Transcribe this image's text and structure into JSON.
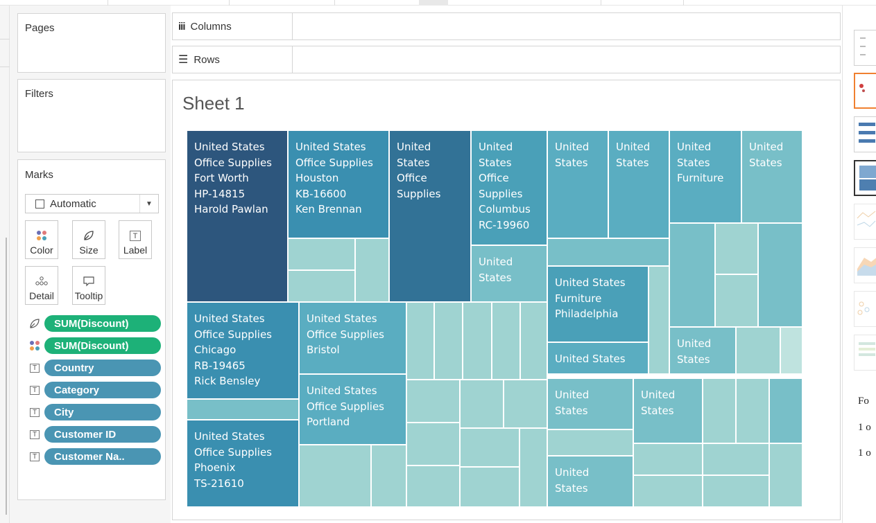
{
  "shelves": {
    "pages_label": "Pages",
    "filters_label": "Filters",
    "columns_label": "Columns",
    "rows_label": "Rows"
  },
  "marks": {
    "title": "Marks",
    "mark_type": "Automatic",
    "buttons": {
      "color": "Color",
      "size": "Size",
      "label": "Label",
      "detail": "Detail",
      "tooltip": "Tooltip"
    },
    "pills": [
      {
        "icon": "size-icon",
        "text": "SUM(Discount)",
        "style": "green"
      },
      {
        "icon": "color-icon",
        "text": "SUM(Discount)",
        "style": "green"
      },
      {
        "icon": "label-icon",
        "text": "Country",
        "style": "blue"
      },
      {
        "icon": "label-icon",
        "text": "Category",
        "style": "blue"
      },
      {
        "icon": "label-icon",
        "text": "City",
        "style": "blue"
      },
      {
        "icon": "label-icon",
        "text": "Customer ID",
        "style": "blue"
      },
      {
        "icon": "label-icon",
        "text": "Customer Na..",
        "style": "blue"
      }
    ]
  },
  "sheet_title": "Sheet 1",
  "colors": {
    "c1": "#2d567d",
    "c2": "#3a8fb0",
    "c3": "#327296",
    "c4": "#4aa0b8",
    "c5": "#5aadc1",
    "c6": "#78bfc8",
    "c7": "#9fd3d1",
    "c8": "#bfe3df",
    "green": "#1db178",
    "blue": "#4a95b3"
  },
  "tiles": {
    "t1": [
      "United States",
      "Office Supplies",
      "Fort Worth",
      "HP-14815",
      "Harold Pawlan"
    ],
    "t2": [
      "United States",
      "Office Supplies",
      "Houston",
      "KB-16600",
      "Ken Brennan"
    ],
    "t3": [
      "United",
      "States",
      "Office",
      "Supplies"
    ],
    "t4": [
      "United",
      "States",
      "Office",
      "Supplies",
      "Columbus",
      "RC-19960"
    ],
    "t5": [
      "United",
      "States"
    ],
    "t6": [
      "United",
      "States"
    ],
    "t7": [
      "United",
      "States"
    ],
    "t8": [
      "United",
      "States",
      "Furniture"
    ],
    "t9": [
      "United",
      "States"
    ],
    "t10": [
      "United States",
      "Furniture",
      "Philadelphia"
    ],
    "t11": [
      "United States"
    ],
    "t12": [
      "United",
      "States"
    ],
    "t13": [
      "United States",
      "Office Supplies",
      "Chicago",
      "RB-19465",
      "Rick Bensley"
    ],
    "t14": [
      "United States",
      "Office Supplies",
      "Bristol"
    ],
    "t15": [
      "United States",
      "Office Supplies",
      "Portland"
    ],
    "t16": [
      "United States",
      "Office Supplies",
      "Phoenix",
      "TS-21610"
    ],
    "t17": [
      "United",
      "States"
    ],
    "t18": [
      "United",
      "States"
    ],
    "t19": [
      "United",
      "States"
    ]
  },
  "right_panel": {
    "text1": "Fo",
    "text2": "1 o",
    "text3": "1 o"
  }
}
